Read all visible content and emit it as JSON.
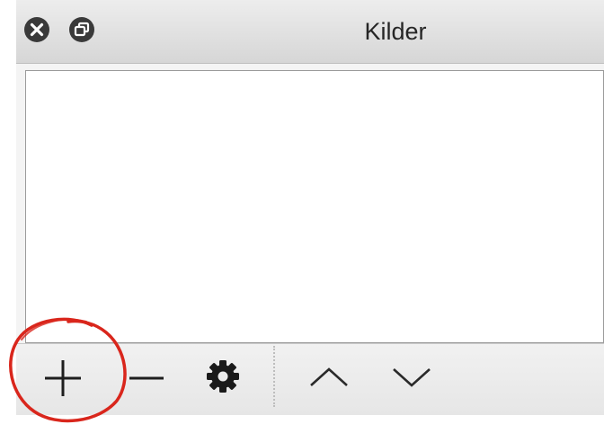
{
  "window": {
    "title": "Kilder",
    "controls": [
      {
        "name": "close-icon"
      },
      {
        "name": "float-window-icon"
      }
    ]
  },
  "sources_list": {
    "items": []
  },
  "toolbar": {
    "buttons": [
      {
        "name": "add-source-button",
        "icon": "plus-icon"
      },
      {
        "name": "remove-source-button",
        "icon": "minus-icon"
      },
      {
        "name": "source-properties-button",
        "icon": "gear-icon"
      },
      {
        "name": "move-source-up-button",
        "icon": "chevron-up-icon"
      },
      {
        "name": "move-source-down-button",
        "icon": "chevron-down-icon"
      }
    ]
  },
  "annotation": {
    "type": "circle-highlight",
    "target": "add-source-button",
    "color": "#d9261c"
  },
  "colors": {
    "titlebar": "#dcdcdc",
    "toolbar": "#ececec",
    "list_background": "#ffffff",
    "window_button": "#3a3a3a",
    "highlight": "#d9261c"
  }
}
